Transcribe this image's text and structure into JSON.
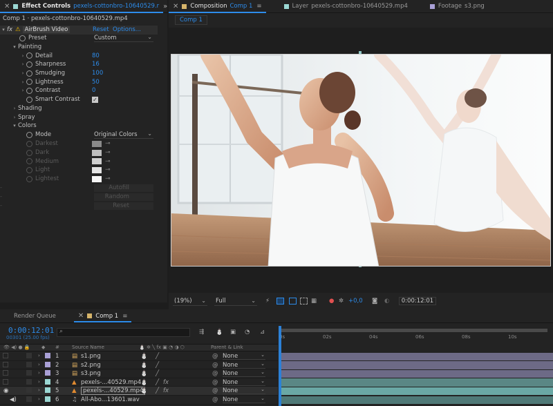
{
  "effect_controls": {
    "tab_title": "Effect Controls",
    "tab_file": "pexels-cottonbro-10640529.r",
    "subheader": "Comp 1 · pexels-cottonbro-10640529.mp4",
    "effect_name": "AirBrush Video",
    "reset_label": "Reset",
    "options_label": "Options...",
    "preset_label": "Preset",
    "preset_value": "Custom",
    "painting_label": "Painting",
    "painting_params": [
      {
        "label": "Detail",
        "value": "80"
      },
      {
        "label": "Sharpness",
        "value": "16"
      },
      {
        "label": "Smudging",
        "value": "100"
      },
      {
        "label": "Lightness",
        "value": "50"
      },
      {
        "label": "Contrast",
        "value": "0"
      }
    ],
    "smart_contrast_label": "Smart Contrast",
    "shading_label": "Shading",
    "spray_label": "Spray",
    "colors_label": "Colors",
    "mode_label": "Mode",
    "mode_value": "Original Colors",
    "color_params": [
      {
        "label": "Darkest",
        "color": "#8a8a8a"
      },
      {
        "label": "Dark",
        "color": "#bdbdbd"
      },
      {
        "label": "Medium",
        "color": "#cfcfcf"
      },
      {
        "label": "Light",
        "color": "#e3e3e3"
      },
      {
        "label": "Lightest",
        "color": "#f5f5f5"
      }
    ],
    "autofill_label": "Autofill",
    "random_label": "Random",
    "reset2_label": "Reset"
  },
  "composition": {
    "tab_title": "Composition",
    "tab_comp": "Comp 1",
    "layer_tab_title": "Layer",
    "layer_tab_file": "pexels-cottonbro-10640529.mp4",
    "footage_tab_title": "Footage",
    "footage_tab_file": "s3.png",
    "sub_tab": "Comp 1",
    "zoom_value": "(19%)",
    "resolution_value": "Full",
    "exposure_value": "+0,0",
    "timecode": "0:00:12:01"
  },
  "timeline": {
    "render_queue_tab": "Render Queue",
    "comp_tab": "Comp 1",
    "current_time": "0:00:12:01",
    "fps_info": "00301 (25.00 fps)",
    "search_placeholder": "",
    "col_source_name": "Source Name",
    "col_parent_link": "Parent & Link",
    "ruler_ticks": [
      "0s",
      "02s",
      "04s",
      "06s",
      "08s",
      "10s"
    ],
    "layers": [
      {
        "num": "1",
        "name": "s1.png",
        "parent": "None",
        "color": "#a9a0d6",
        "fx": false,
        "selected": false
      },
      {
        "num": "2",
        "name": "s2.png",
        "parent": "None",
        "color": "#a9a0d6",
        "fx": false,
        "selected": false
      },
      {
        "num": "3",
        "name": "s3.png",
        "parent": "None",
        "color": "#a9a0d6",
        "fx": false,
        "selected": false
      },
      {
        "num": "4",
        "name": "pexels-...40529.mp4",
        "parent": "None",
        "color": "#9ad7d3",
        "fx": true,
        "selected": false
      },
      {
        "num": "5",
        "name": "pexels-...40529.mp4",
        "parent": "None",
        "color": "#9ad7d3",
        "fx": true,
        "selected": true
      },
      {
        "num": "6",
        "name": "All-Abo...13601.wav",
        "parent": "None",
        "color": "#9ad7d3",
        "fx": false,
        "selected": false
      }
    ]
  }
}
